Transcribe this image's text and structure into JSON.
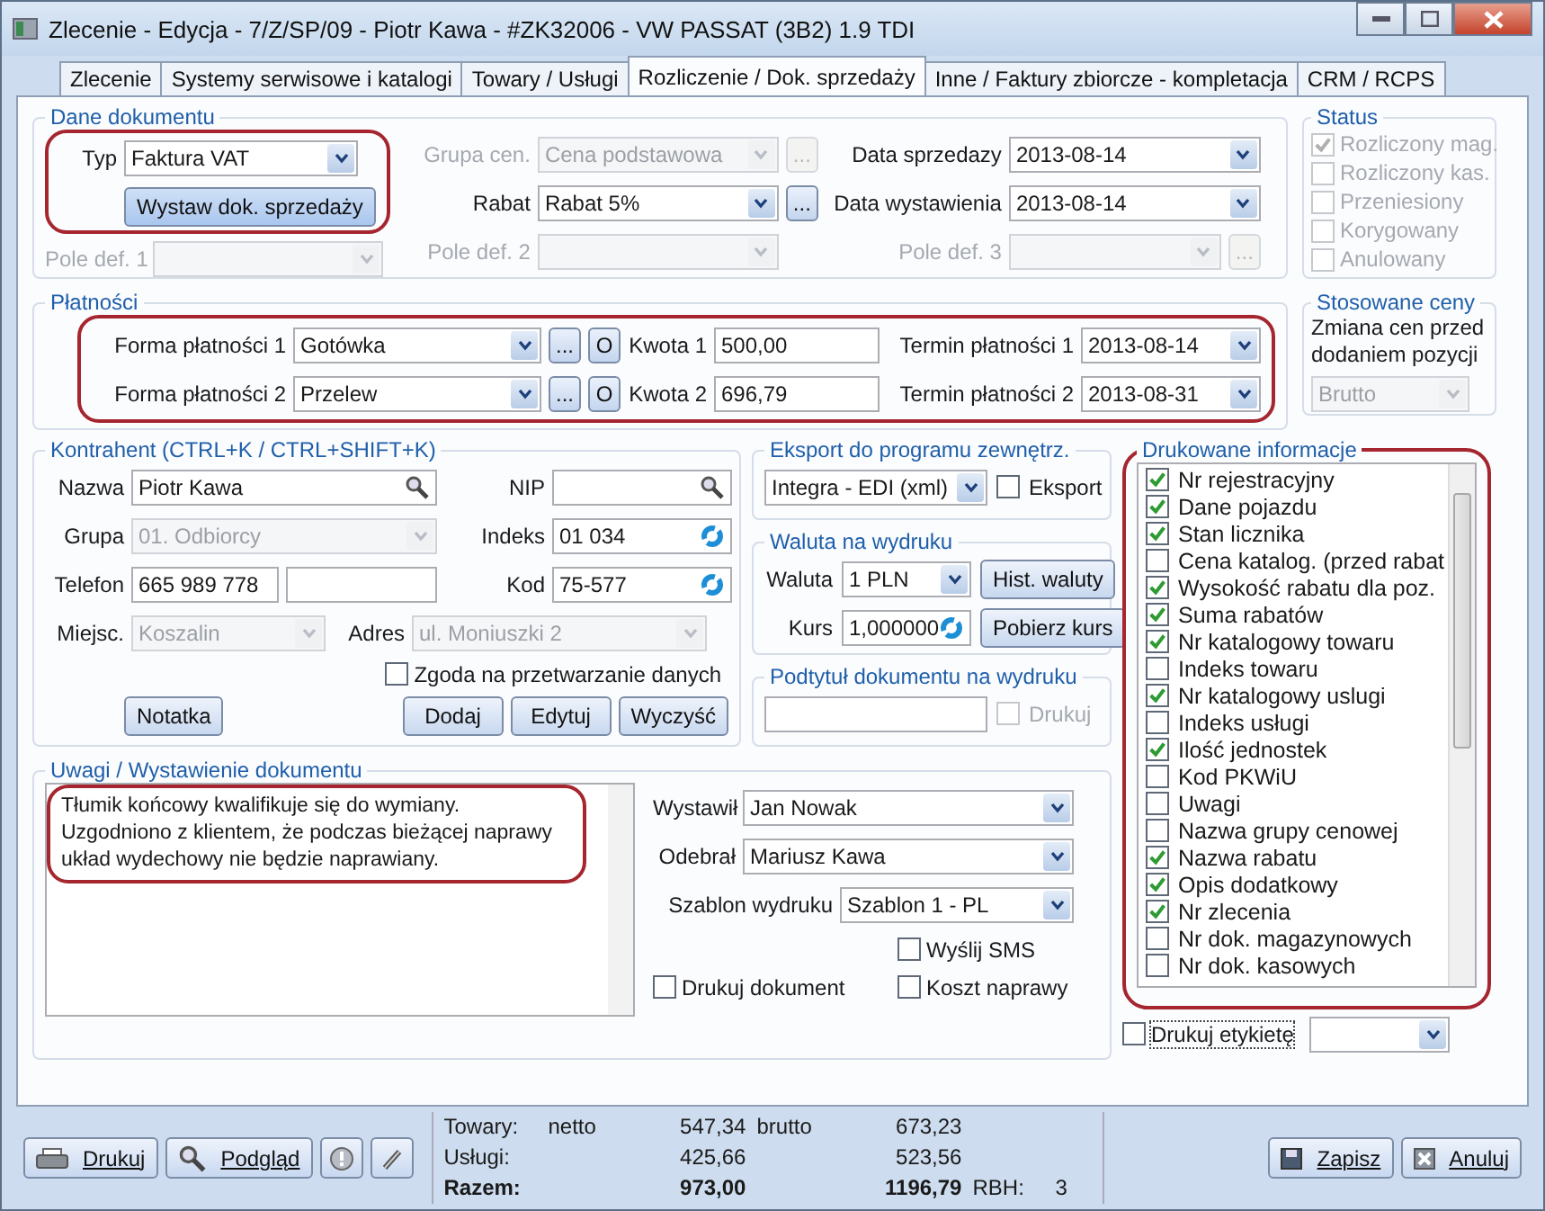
{
  "window": {
    "title": "Zlecenie - Edycja - 7/Z/SP/09 - Piotr Kawa - #ZK32006 - VW PASSAT (3B2) 1.9 TDI"
  },
  "tabs": [
    {
      "label": "Zlecenie",
      "selected": false
    },
    {
      "label": "Systemy serwisowe i katalogi",
      "selected": false
    },
    {
      "label": "Towary / Usługi",
      "selected": false
    },
    {
      "label": "Rozliczenie / Dok. sprzedaży",
      "selected": true
    },
    {
      "label": "Inne / Faktury zbiorcze - kompletacja",
      "selected": false
    },
    {
      "label": "CRM / RCPS",
      "selected": false
    }
  ],
  "document": {
    "legend": "Dane dokumentu",
    "annotated": true,
    "type": {
      "label": "Typ",
      "value": "Faktura VAT"
    },
    "issue_button": "Wystaw dok. sprzedaży",
    "custom_1": {
      "label": "Pole def. 1",
      "disabled": true
    },
    "price_group": {
      "label": "Grupa cen.",
      "value": "Cena podstawowa",
      "disabled": true,
      "more": "..."
    },
    "discount": {
      "label": "Rabat",
      "value": "Rabat 5%",
      "more": "..."
    },
    "custom_2": {
      "label": "Pole def. 2",
      "disabled": true
    },
    "sale_date": {
      "label": "Data sprzedazy",
      "value": "2013-08-14"
    },
    "issue_date": {
      "label": "Data wystawienia",
      "value": "2013-08-14"
    },
    "custom_3": {
      "label": "Pole def. 3",
      "disabled": true,
      "more": "..."
    }
  },
  "status": {
    "legend": "Status",
    "items": [
      {
        "label": "Rozliczony mag.",
        "checked": true,
        "disabled": true
      },
      {
        "label": "Rozliczony kas.",
        "checked": false,
        "disabled": true
      },
      {
        "label": "Przeniesiony",
        "checked": false,
        "disabled": true
      },
      {
        "label": "Korygowany",
        "checked": false,
        "disabled": true
      },
      {
        "label": "Anulowany",
        "checked": false,
        "disabled": true
      }
    ]
  },
  "payments": {
    "legend": "Płatności",
    "annotated": true,
    "rows": [
      {
        "label": "Forma płatności 1",
        "method": {
          "value": "Gotówka"
        },
        "more": "...",
        "o": "O",
        "amount_label": "Kwota 1",
        "amount": {
          "value": "500,00"
        },
        "due_label": "Termin płatności 1",
        "due": {
          "value": "2013-08-14"
        }
      },
      {
        "label": "Forma płatności 2",
        "method": {
          "value": "Przelew"
        },
        "more": "...",
        "o": "O",
        "amount_label": "Kwota 2",
        "amount": {
          "value": "696,79"
        },
        "due_label": "Termin płatności 2",
        "due": {
          "value": "2013-08-31"
        }
      }
    ]
  },
  "prices": {
    "legend": "Stosowane ceny",
    "caption": "Zmiana cen przed dodaniem pozycji",
    "field": {
      "value": "Brutto",
      "disabled": true
    }
  },
  "contractor": {
    "legend": "Kontrahent (CTRL+K / CTRL+SHIFT+K)",
    "name": {
      "label": "Nazwa",
      "value": "Piotr Kawa"
    },
    "nip": {
      "label": "NIP"
    },
    "group": {
      "label": "Grupa",
      "value": "01. Odbiorcy",
      "disabled": true
    },
    "index": {
      "label": "Indeks",
      "value": "01 034"
    },
    "phone": {
      "label": "Telefon",
      "value": "665 989 778"
    },
    "zip": {
      "label": "Kod",
      "value": "75-577"
    },
    "city": {
      "label": "Miejsc.",
      "value": "Koszalin",
      "disabled": true
    },
    "address": {
      "label": "Adres",
      "value": "ul. Moniuszki 2",
      "disabled": true
    },
    "consent": {
      "label": "Zgoda na przetwarzanie danych",
      "checked": false
    },
    "note_button": "Notatka",
    "add_button": "Dodaj",
    "edit_button": "Edytuj",
    "clear_button": "Wyczyść"
  },
  "export": {
    "legend": "Eksport do programu zewnętrz.",
    "field": {
      "value": "Integra - EDI (xml)"
    },
    "check": {
      "label": "Eksport",
      "checked": false
    }
  },
  "currency": {
    "legend": "Waluta na wydruku",
    "currency": {
      "label": "Waluta",
      "value": "1 PLN"
    },
    "history_button": "Hist. waluty",
    "rate": {
      "label": "Kurs",
      "value": "1,000000"
    },
    "fetch_button": "Pobierz kurs"
  },
  "subtitle": {
    "legend": "Podtytuł dokumentu na wydruku",
    "print": {
      "label": "Drukuj",
      "checked": false,
      "disabled": true
    }
  },
  "printed_info": {
    "legend": "Drukowane informacje",
    "annotated": true,
    "items": [
      {
        "label": "Nr rejestracyjny",
        "checked": true
      },
      {
        "label": "Dane pojazdu",
        "checked": true
      },
      {
        "label": "Stan licznika",
        "checked": true
      },
      {
        "label": "Cena katalog. (przed rabat",
        "checked": false
      },
      {
        "label": "Wysokość rabatu dla poz.",
        "checked": true
      },
      {
        "label": "Suma rabatów",
        "checked": true
      },
      {
        "label": "Nr katalogowy towaru",
        "checked": true
      },
      {
        "label": "Indeks towaru",
        "checked": false
      },
      {
        "label": "Nr katalogowy uslugi",
        "checked": true
      },
      {
        "label": "Indeks usługi",
        "checked": false
      },
      {
        "label": "Ilość jednostek",
        "checked": true
      },
      {
        "label": "Kod PKWiU",
        "checked": false
      },
      {
        "label": "Uwagi",
        "checked": false
      },
      {
        "label": "Nazwa grupy cenowej",
        "checked": false
      },
      {
        "label": "Nazwa rabatu",
        "checked": true
      },
      {
        "label": "Opis dodatkowy",
        "checked": true
      },
      {
        "label": "Nr zlecenia",
        "checked": true
      },
      {
        "label": "Nr dok. magazynowych",
        "checked": false
      },
      {
        "label": "Nr dok. kasowych",
        "checked": false
      }
    ],
    "label_print": {
      "label": "Drukuj etykietę",
      "checked": false
    }
  },
  "notes": {
    "legend": "Uwagi / Wystawienie dokumentu",
    "annotated": true,
    "text": "Tłumik końcowy kwalifikuje się do wymiany. Uzgodniono z klientem, że podczas bieżącej naprawy układ wydechowy nie będzie naprawiany.",
    "issued_by": {
      "label": "Wystawił",
      "value": "Jan Nowak"
    },
    "received_by": {
      "label": "Odebrał",
      "value": "Mariusz Kawa"
    },
    "template": {
      "label": "Szablon wydruku",
      "value": "Szablon 1 - PL"
    },
    "send_sms": {
      "label": "Wyślij SMS",
      "checked": false
    },
    "print_doc": {
      "label": "Drukuj dokument",
      "checked": false
    },
    "repair_cost": {
      "label": "Koszt naprawy",
      "checked": false
    }
  },
  "footer": {
    "print_button": "Drukuj",
    "preview_button": "Podgląd",
    "totals": [
      {
        "kind": "line",
        "label": "Towary:",
        "net_label": "netto",
        "net": "547,34",
        "gross_label": "brutto",
        "gross": "673,23"
      },
      {
        "kind": "line",
        "label": "Usługi:",
        "net": "425,66",
        "gross": "523,56"
      },
      {
        "kind": "total",
        "label": "Razem:",
        "net": "973,00",
        "gross": "1196,79"
      }
    ],
    "rbh": {
      "label": "RBH:",
      "value": "3"
    },
    "save_button": "Zapisz",
    "cancel_button": "Anuluj"
  }
}
